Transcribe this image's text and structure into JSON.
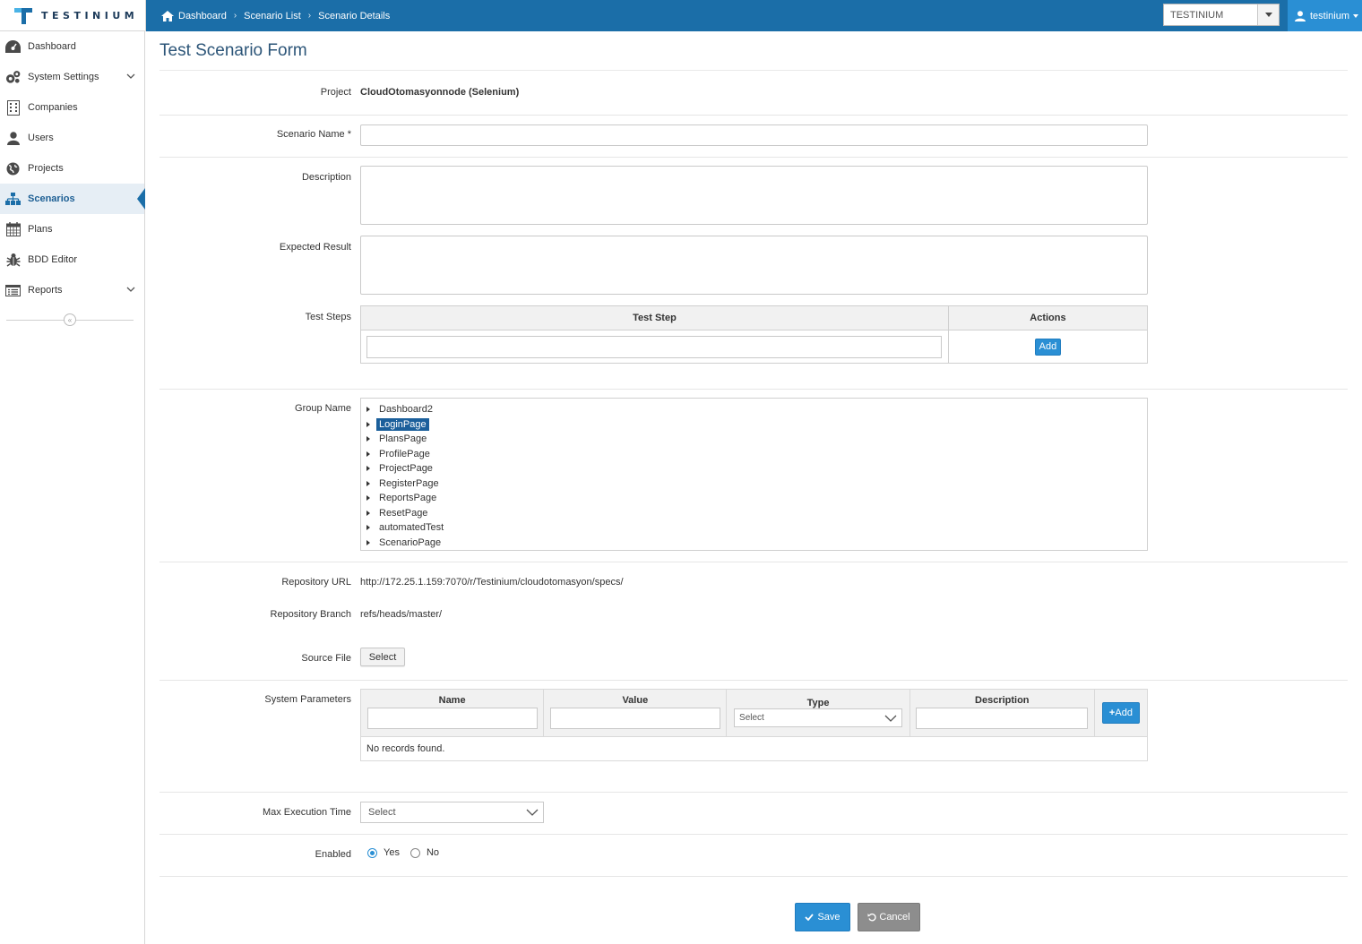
{
  "app": {
    "logo_text": "TESTINIUM"
  },
  "breadcrumb": [
    "Dashboard",
    "Scenario List",
    "Scenario Details"
  ],
  "header": {
    "project_select": "TESTINIUM",
    "user": "testinium"
  },
  "sidebar": {
    "items": [
      {
        "label": "Dashboard",
        "icon": "dashboard-icon"
      },
      {
        "label": "System Settings",
        "icon": "gears-icon",
        "expandable": true
      },
      {
        "label": "Companies",
        "icon": "building-icon"
      },
      {
        "label": "Users",
        "icon": "user-icon"
      },
      {
        "label": "Projects",
        "icon": "globe-icon"
      },
      {
        "label": "Scenarios",
        "icon": "sitemap-icon",
        "active": true
      },
      {
        "label": "Plans",
        "icon": "calendar-icon"
      },
      {
        "label": "BDD Editor",
        "icon": "bug-icon"
      },
      {
        "label": "Reports",
        "icon": "list-icon",
        "expandable": true
      }
    ]
  },
  "form": {
    "title": "Test Scenario Form",
    "project_label": "Project",
    "project_value": "CloudOtomasyonnode (Selenium)",
    "scenario_name_label": "Scenario Name *",
    "description_label": "Description",
    "expected_result_label": "Expected Result",
    "test_steps_label": "Test Steps",
    "test_steps_col_step": "Test Step",
    "test_steps_col_actions": "Actions",
    "test_steps_add": "Add",
    "group_name_label": "Group Name",
    "groups": [
      "Dashboard2",
      "LoginPage",
      "PlansPage",
      "ProfilePage",
      "ProjectPage",
      "RegisterPage",
      "ReportsPage",
      "ResetPage",
      "automatedTest",
      "ScenarioPage"
    ],
    "selected_group": "LoginPage",
    "repo_url_label": "Repository URL",
    "repo_url_value": "http://172.25.1.159:7070/r/Testinium/cloudotomasyon/specs/",
    "repo_branch_label": "Repository Branch",
    "repo_branch_value": "refs/heads/master/",
    "source_file_label": "Source File",
    "source_file_button": "Select",
    "system_params_label": "System Parameters",
    "params_cols": {
      "name": "Name",
      "value": "Value",
      "type": "Type",
      "description": "Description"
    },
    "params_type_placeholder": "Select",
    "params_add": "Add",
    "params_empty": "No records found.",
    "max_exec_label": "Max Execution Time",
    "max_exec_value": "Select",
    "enabled_label": "Enabled",
    "enabled_yes": "Yes",
    "enabled_no": "No",
    "enabled_selected": "Yes",
    "save_button": "Save",
    "cancel_button": "Cancel"
  },
  "colors": {
    "header_bg": "#1b6ea8",
    "accent": "#2a8fd4",
    "selected": "#1b5f9b",
    "cancel_bg": "#8d8d8d"
  }
}
